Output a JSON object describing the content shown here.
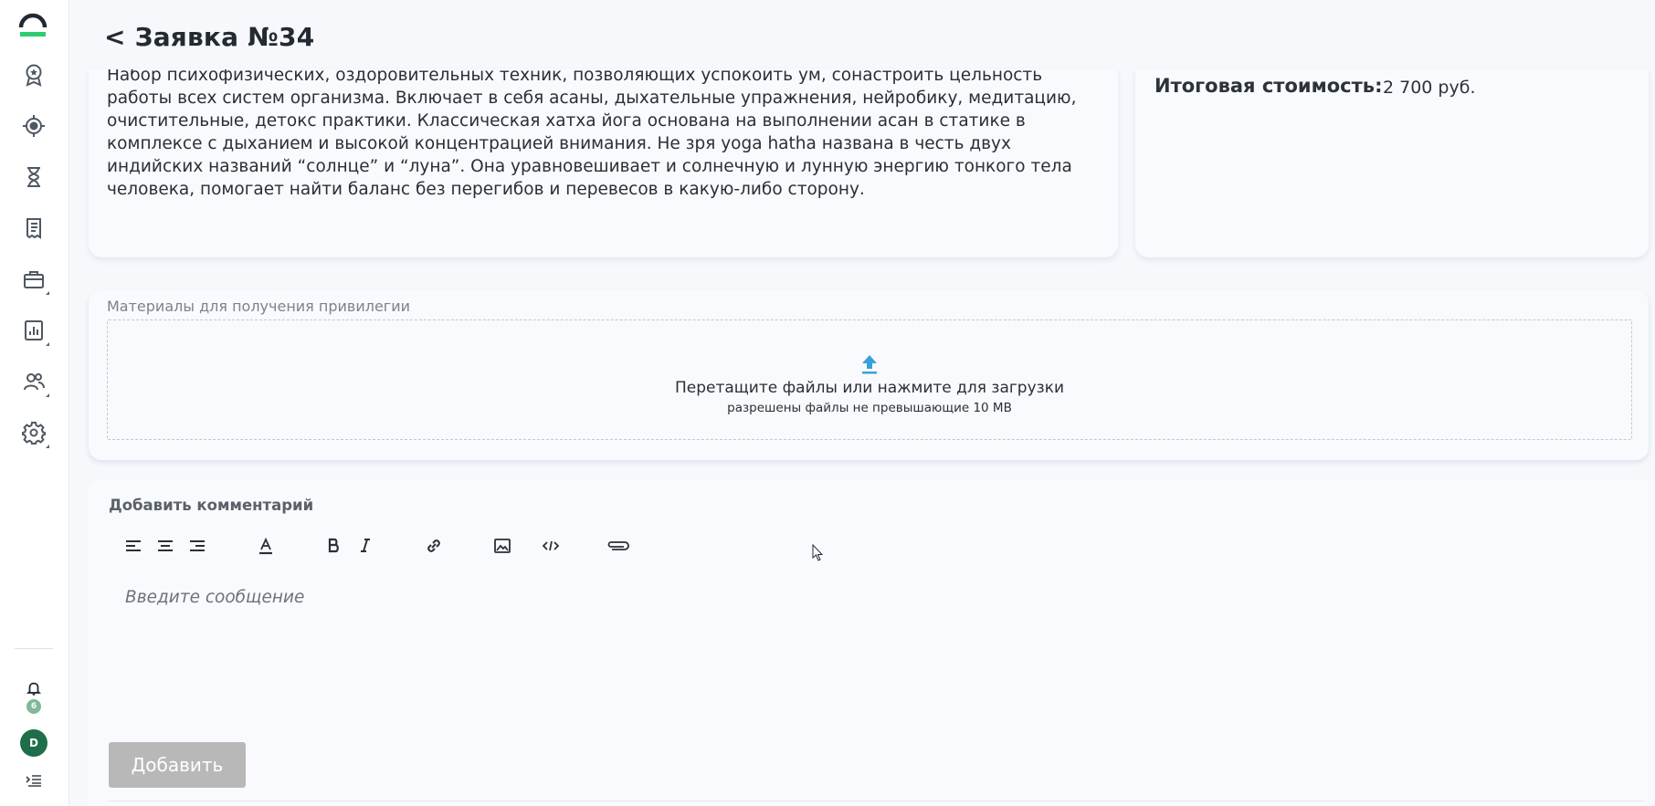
{
  "header": {
    "title": "< Заявка №34"
  },
  "sidebar": {
    "items": [
      {
        "name": "award-icon"
      },
      {
        "name": "target-icon"
      },
      {
        "name": "hourglass-icon"
      },
      {
        "name": "receipt-icon"
      },
      {
        "name": "briefcase-icon"
      },
      {
        "name": "report-icon"
      },
      {
        "name": "users-icon"
      },
      {
        "name": "gear-icon"
      }
    ],
    "notifications_badge": "6",
    "avatar_initial": "D"
  },
  "description": {
    "text": "Набор психофизических, оздоровительных техник, позволяющих успокоить ум, сонастроить цельность работы всех систем организма. Включает в себя асаны, дыхательные упражнения, нейробику, медитацию, очистительные, детокс практики. Классическая хатха йога основана на выполнении асан в статике в комплексе с дыханием и высокой концентрацией внимания. Не зря yoga hatha названа в честь двух индийских названий “солнце” и “луна”. Она уравновешивает и солнечную и лунную энергию тонкого тела человека, помогает найти баланс без перегибов и перевесов в какую-либо сторону."
  },
  "cost": {
    "label": "Итоговая стоимость:",
    "value": "2 700 руб."
  },
  "materials": {
    "label": "Материалы для получения привилегии",
    "dropzone_main": "Перетащите файлы или нажмите для загрузки",
    "dropzone_sub": "разрешены файлы не превышающие 10 MB"
  },
  "comment": {
    "title": "Добавить комментарий",
    "placeholder": "Введите сообщение",
    "submit_label": "Добавить"
  },
  "colors": {
    "accent_green": "#2ecc71",
    "upload_blue": "#3aa0d8",
    "avatar_green": "#1e6e4a",
    "button_disabled": "#b8b8b8"
  }
}
